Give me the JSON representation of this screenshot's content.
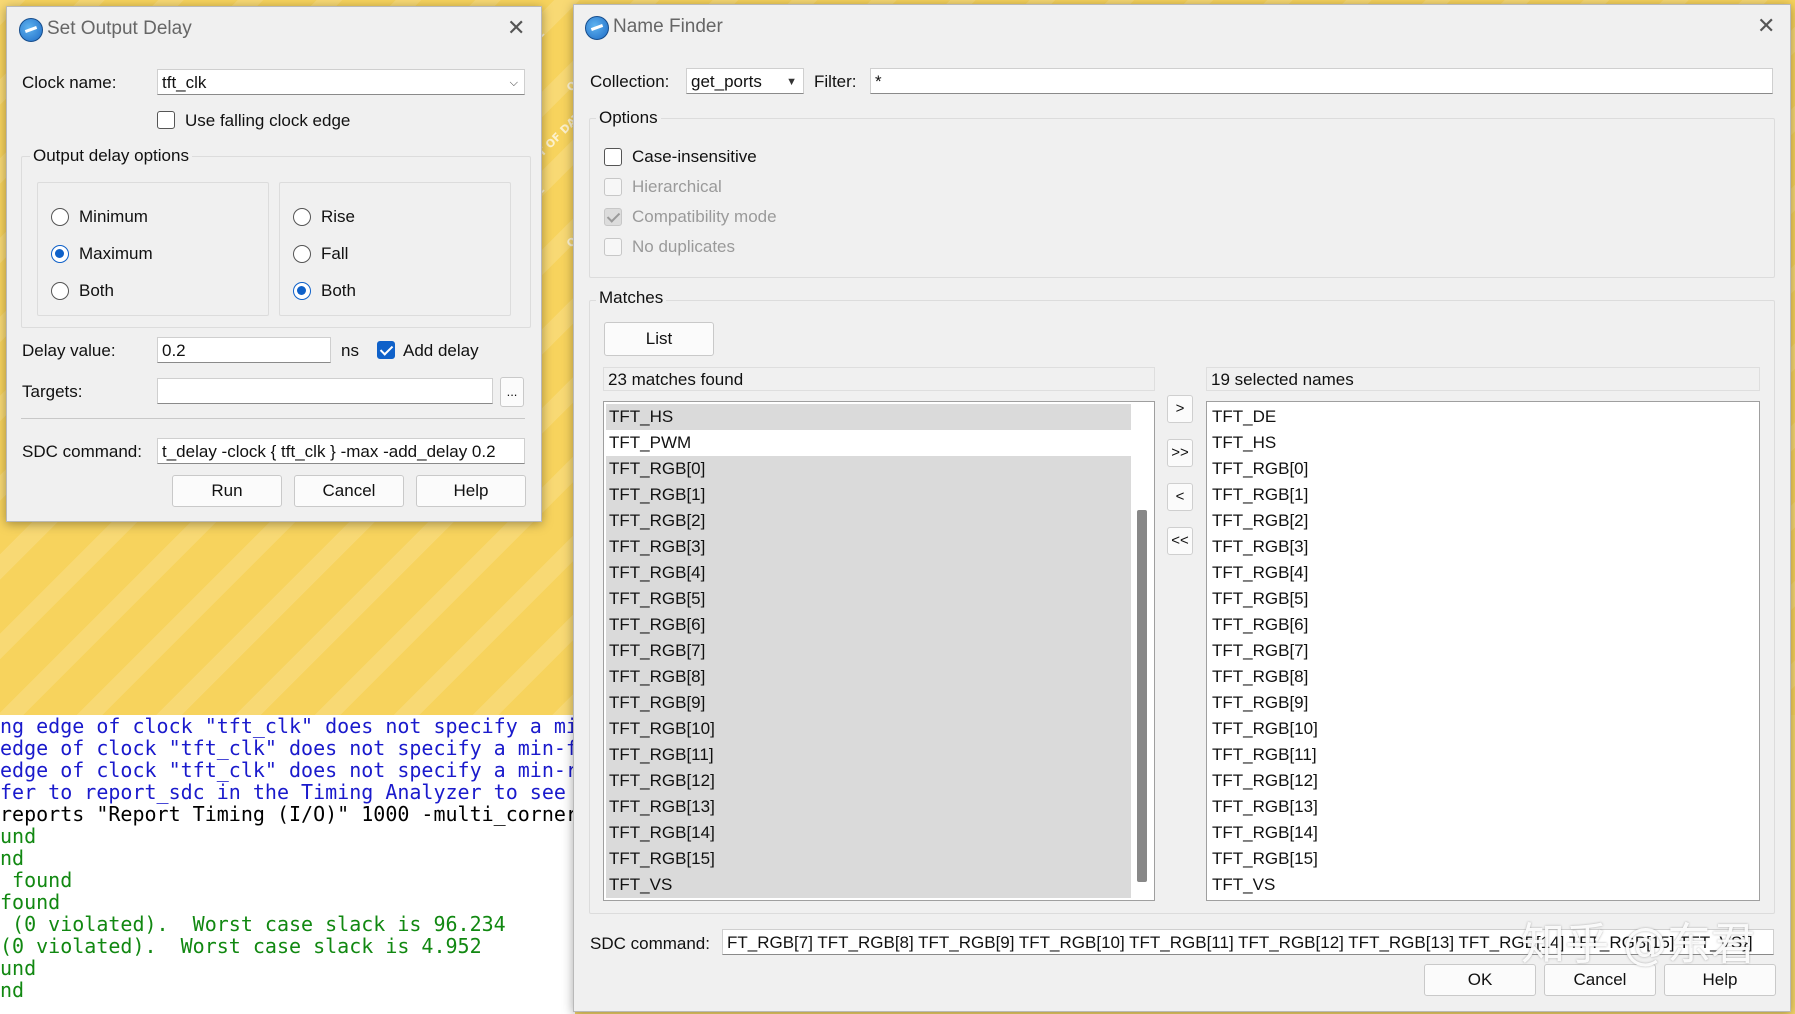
{
  "output_delay_dialog": {
    "title": "Set Output Delay",
    "clock_name_label": "Clock name:",
    "clock_name_value": "tft_clk",
    "use_falling_edge_label": "Use falling clock edge",
    "options_group_title": "Output delay options",
    "min_max": [
      {
        "label": "Minimum",
        "selected": false
      },
      {
        "label": "Maximum",
        "selected": true
      },
      {
        "label": "Both",
        "selected": false
      }
    ],
    "rise_fall": [
      {
        "label": "Rise",
        "selected": false
      },
      {
        "label": "Fall",
        "selected": false
      },
      {
        "label": "Both",
        "selected": true
      }
    ],
    "delay_value_label": "Delay value:",
    "delay_value": "0.2",
    "delay_unit": "ns",
    "add_delay_label": "Add delay",
    "add_delay_checked": true,
    "targets_label": "Targets:",
    "targets_value": "",
    "browse_label": "...",
    "sdc_label": "SDC command:",
    "sdc_value": "t_delay -clock { tft_clk } -max -add_delay 0.2",
    "buttons": {
      "run": "Run",
      "cancel": "Cancel",
      "help": "Help"
    }
  },
  "name_finder_dialog": {
    "title": "Name Finder",
    "collection_label": "Collection:",
    "collection_value": "get_ports",
    "filter_label": "Filter:",
    "filter_value": "*",
    "options_title": "Options",
    "options": [
      {
        "label": "Case-insensitive",
        "checked": false,
        "enabled": true
      },
      {
        "label": "Hierarchical",
        "checked": false,
        "enabled": false
      },
      {
        "label": "Compatibility mode",
        "checked": true,
        "enabled": false
      },
      {
        "label": "No duplicates",
        "checked": false,
        "enabled": false
      }
    ],
    "matches_title": "Matches",
    "list_button": "List",
    "matches_header": "23 matches found",
    "matches": [
      "TFT_HS",
      "TFT_PWM",
      "TFT_RGB[0]",
      "TFT_RGB[1]",
      "TFT_RGB[2]",
      "TFT_RGB[3]",
      "TFT_RGB[4]",
      "TFT_RGB[5]",
      "TFT_RGB[6]",
      "TFT_RGB[7]",
      "TFT_RGB[8]",
      "TFT_RGB[9]",
      "TFT_RGB[10]",
      "TFT_RGB[11]",
      "TFT_RGB[12]",
      "TFT_RGB[13]",
      "TFT_RGB[14]",
      "TFT_RGB[15]",
      "TFT_VS"
    ],
    "selected_header": "19 selected names",
    "selected": [
      "TFT_DE",
      "TFT_HS",
      "TFT_RGB[0]",
      "TFT_RGB[1]",
      "TFT_RGB[2]",
      "TFT_RGB[3]",
      "TFT_RGB[4]",
      "TFT_RGB[5]",
      "TFT_RGB[6]",
      "TFT_RGB[7]",
      "TFT_RGB[8]",
      "TFT_RGB[9]",
      "TFT_RGB[10]",
      "TFT_RGB[11]",
      "TFT_RGB[12]",
      "TFT_RGB[13]",
      "TFT_RGB[14]",
      "TFT_RGB[15]",
      "TFT_VS"
    ],
    "arrows": {
      "add": ">",
      "add_all": ">>",
      "remove": "<",
      "remove_all": "<<"
    },
    "sdc_label": "SDC command:",
    "sdc_value": "FT_RGB[7] TFT_RGB[8] TFT_RGB[9] TFT_RGB[10] TFT_RGB[11] TFT_RGB[12] TFT_RGB[13] TFT_RGB[14] TFT_RGB[15] TFT_VS}]",
    "buttons": {
      "ok": "OK",
      "cancel": "Cancel",
      "help": "Help"
    }
  },
  "background": {
    "watermark_text": "OUT OF DATE",
    "console_lines": [
      {
        "text": "ng edge of clock \"tft_clk\" does not specify a mi",
        "color": "#1a1acc"
      },
      {
        "text": "edge of clock \"tft_clk\" does not specify a min-fa",
        "color": "#1a1acc"
      },
      {
        "text": "edge of clock \"tft_clk\" does not specify a min-ri",
        "color": "#1a1acc"
      },
      {
        "text": "fer to report_sdc in the Timing Analyzer to see c",
        "color": "#1a1acc"
      },
      {
        "text": "reports \"Report Timing (I/O)\" 1000 -multi_corner",
        "color": "#000000"
      },
      {
        "text": "und",
        "color": "#118811"
      },
      {
        "text": "nd",
        "color": "#118811"
      },
      {
        "text": " found",
        "color": "#118811"
      },
      {
        "text": "found",
        "color": "#118811"
      },
      {
        "text": " (0 violated).  Worst case slack is 96.234",
        "color": "#118811"
      },
      {
        "text": "(0 violated).  Worst case slack is 4.952",
        "color": "#118811"
      },
      {
        "text": "und",
        "color": "#118811"
      },
      {
        "text": "nd",
        "color": "#118811"
      }
    ],
    "zhihu_mark": "知乎 @东君"
  }
}
